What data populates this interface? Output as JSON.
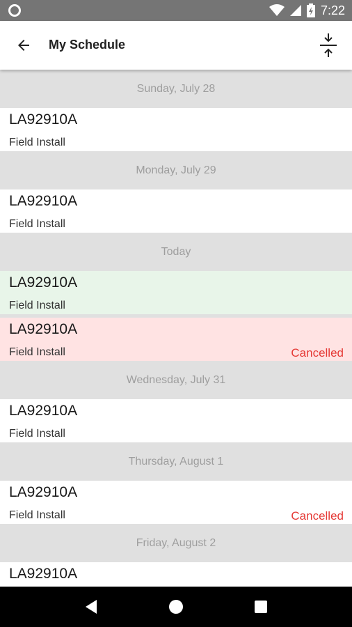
{
  "status_bar": {
    "time": "7:22"
  },
  "app_bar": {
    "title": "My Schedule"
  },
  "schedule": [
    {
      "date": "Sunday, July 28",
      "items": [
        {
          "code": "LA92910A",
          "type": "Field Install",
          "status": ""
        }
      ]
    },
    {
      "date": "Monday, July 29",
      "items": [
        {
          "code": "LA92910A",
          "type": "Field Install",
          "status": ""
        }
      ]
    },
    {
      "date": "Today",
      "items": [
        {
          "code": "LA92910A",
          "type": "Field Install",
          "status": ""
        },
        {
          "code": "LA92910A",
          "type": "Field Install",
          "status": "Cancelled"
        }
      ]
    },
    {
      "date": "Wednesday, July 31",
      "items": [
        {
          "code": "LA92910A",
          "type": "Field Install",
          "status": ""
        }
      ]
    },
    {
      "date": "Thursday, August 1",
      "items": [
        {
          "code": "LA92910A",
          "type": "Field Install",
          "status": "Cancelled"
        }
      ]
    },
    {
      "date": "Friday, August 2",
      "items": [
        {
          "code": "LA92910A",
          "type": "",
          "status": ""
        }
      ]
    }
  ],
  "colors": {
    "today_bg": "#e8f5e9",
    "cancelled_bg": "#ffe3e3",
    "cancelled_text": "#e53935",
    "header_bg": "#e0e0e0"
  },
  "icons": {
    "back": "arrow-left-icon",
    "collapse": "collapse-vertical-icon"
  }
}
